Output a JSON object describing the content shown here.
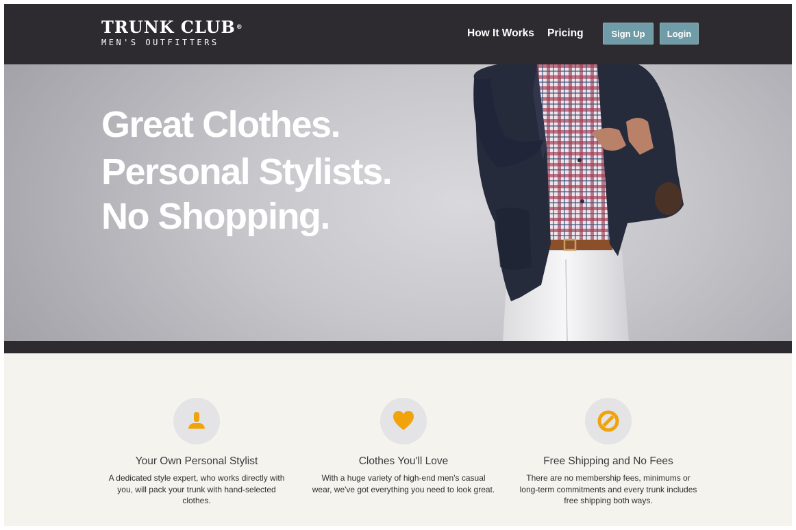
{
  "header": {
    "logo": {
      "main": "TRUNK CLUB",
      "registered": "®",
      "sub": "MEN'S OUTFITTERS"
    },
    "nav": [
      {
        "label": "How It Works"
      },
      {
        "label": "Pricing"
      }
    ],
    "buttons": {
      "signup": "Sign Up",
      "login": "Login"
    }
  },
  "hero": {
    "lines": [
      "Great Clothes.",
      "Personal Stylists.",
      "No Shopping."
    ]
  },
  "features": [
    {
      "icon": "person-icon",
      "title": "Your Own Personal Stylist",
      "description": "A dedicated style expert, who works directly with you, will pack your trunk with hand-selected clothes."
    },
    {
      "icon": "heart-icon",
      "title": "Clothes You'll Love",
      "description": "With a huge variety of high-end men's casual wear, we've got everything you need to look great."
    },
    {
      "icon": "no-fees-icon",
      "title": "Free Shipping and No Fees",
      "description": "There are no membership fees, minimums or long-term commitments and every trunk includes free shipping both ways."
    }
  ],
  "colors": {
    "header_bg": "#2d2b30",
    "button_bg": "#6f9ca6",
    "accent_orange": "#f0a30a",
    "features_bg": "#f4f3ee"
  }
}
